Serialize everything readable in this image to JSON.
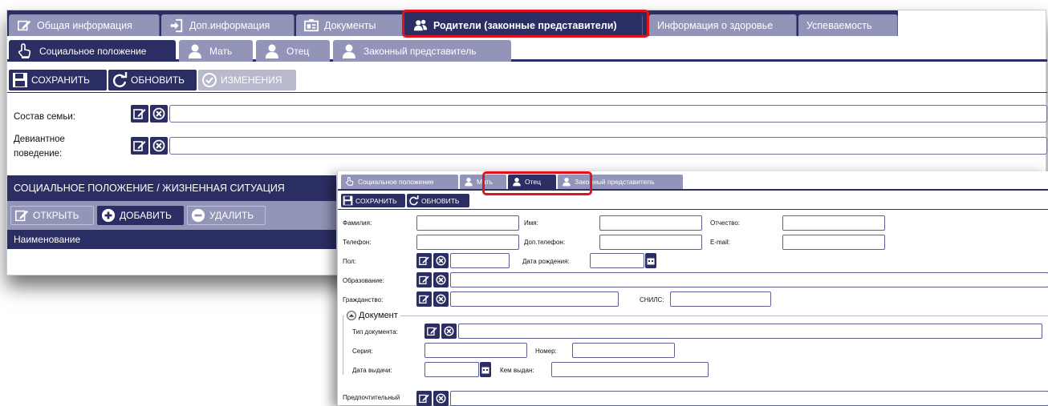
{
  "main": {
    "tabs": [
      {
        "label": "Общая информация",
        "icon": "edit-icon"
      },
      {
        "label": "Доп.информация",
        "icon": "sign-in-icon"
      },
      {
        "label": "Документы",
        "icon": "id-card-icon"
      },
      {
        "label": "Родители (законные представители)",
        "icon": "users-icon",
        "active": true
      },
      {
        "label": "Информация о здоровье"
      },
      {
        "label": "Успеваемость"
      }
    ],
    "subtabs": [
      {
        "label": "Социальное положение",
        "icon": "hand-pointer-icon",
        "active": true
      },
      {
        "label": "Мать",
        "icon": "user-icon"
      },
      {
        "label": "Отец",
        "icon": "user-icon"
      },
      {
        "label": "Законный представитель",
        "icon": "user-icon"
      }
    ],
    "toolbar": {
      "save": "СОХРАНИТЬ",
      "refresh": "ОБНОВИТЬ",
      "changes": "ИЗМЕНЕНИЯ"
    },
    "fields": {
      "family": "Состав семьи:",
      "deviant_line1": "Девиантное",
      "deviant_line2": "поведение:"
    },
    "section": {
      "title": "СОЦИАЛЬНОЕ ПОЛОЖЕНИЕ / ЖИЗНЕННАЯ СИТУАЦИЯ",
      "open": "ОТКРЫТЬ",
      "add": "ДОБАВИТЬ",
      "delete": "УДАЛИТЬ",
      "column": "Наименование"
    }
  },
  "overlay": {
    "tabs": [
      {
        "label": "Социальное положение"
      },
      {
        "label": "Мать"
      },
      {
        "label": "Отец",
        "active": true
      },
      {
        "label": "Законный представитель"
      }
    ],
    "toolbar": {
      "save": "СОХРАНИТЬ",
      "refresh": "ОБНОВИТЬ"
    },
    "labels": {
      "surname": "Фамилия:",
      "name": "Имя:",
      "patronymic": "Отчество:",
      "phone": "Телефон:",
      "phone2": "Доп.телефон:",
      "email": "E-mail:",
      "gender": "Пол:",
      "birthdate": "Дата рождения:",
      "education": "Образование:",
      "citizenship": "Гражданство:",
      "snils": "СНИЛС:",
      "doc_group": "Документ",
      "doc_type": "Тип документа:",
      "series": "Серия:",
      "number": "Номер:",
      "issue_date": "Дата выдачи:",
      "issued_by": "Кем выдан:",
      "preferred": "Предпочтительный"
    }
  },
  "colors": {
    "primary": "#2b2e63",
    "tab_inactive": "#9294b8",
    "highlight": "#e0131b"
  }
}
